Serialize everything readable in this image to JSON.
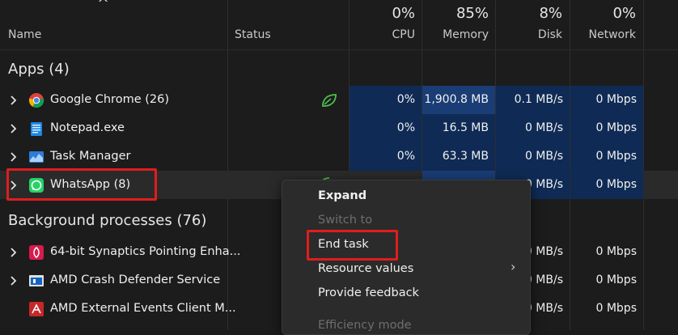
{
  "header": {
    "sort_arrow": "^",
    "name_label": "Name",
    "status_label": "Status",
    "cpu": {
      "pct": "0%",
      "label": "CPU"
    },
    "memory": {
      "pct": "85%",
      "label": "Memory"
    },
    "disk": {
      "pct": "8%",
      "label": "Disk"
    },
    "network": {
      "pct": "0%",
      "label": "Network"
    }
  },
  "apps": {
    "title": "Apps (4)",
    "rows": [
      {
        "name": "Google Chrome (26)",
        "icon": "chrome-icon",
        "status_icon": "efficiency-leaf-icon",
        "cpu": "0%",
        "memory": "1,900.8 MB",
        "disk": "0.1 MB/s",
        "network": "0 Mbps"
      },
      {
        "name": "Notepad.exe",
        "icon": "notepad-icon",
        "cpu": "0%",
        "memory": "16.5 MB",
        "disk": "0 MB/s",
        "network": "0 Mbps"
      },
      {
        "name": "Task Manager",
        "icon": "task-manager-icon",
        "cpu": "0%",
        "memory": "63.3 MB",
        "disk": "0 MB/s",
        "network": "0 Mbps"
      },
      {
        "name": "WhatsApp (8)",
        "icon": "whatsapp-icon",
        "disk": "0 MB/s",
        "network": "0 Mbps"
      }
    ]
  },
  "background": {
    "title": "Background processes (76)",
    "rows": [
      {
        "name": "64-bit Synaptics Pointing Enha...",
        "icon": "synaptics-icon",
        "disk": "0 MB/s",
        "network": "0 Mbps"
      },
      {
        "name": "AMD Crash Defender Service",
        "icon": "amd-service-icon",
        "disk": "0 MB/s",
        "network": "0 Mbps"
      },
      {
        "name": "AMD External Events Client M...",
        "icon": "amd-icon",
        "disk": "0 MB/s",
        "network": "0 Mbps"
      }
    ]
  },
  "context_menu": {
    "expand": "Expand",
    "switch_to": "Switch to",
    "end_task": "End task",
    "resource_values": "Resource values",
    "submenu_arrow": "›",
    "provide_feedback": "Provide feedback",
    "efficiency_mode": "Efficiency mode"
  },
  "colors": {
    "highlight_box": "#e01d1d",
    "heat_cell": "#0f2b55",
    "memory_heat_cell": "#1a3d75"
  }
}
